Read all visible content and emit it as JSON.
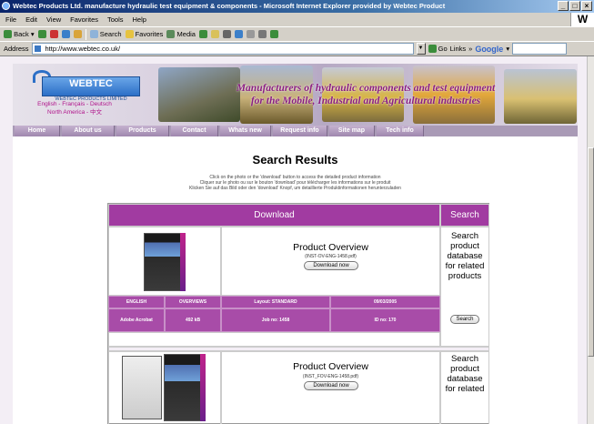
{
  "window": {
    "title": "Webtec Products Ltd. manufacture hydraulic test equipment & components - Microsoft Internet Explorer provided by Webtec Product",
    "buttons": [
      "_",
      "□",
      "×"
    ]
  },
  "menu": {
    "items": [
      "File",
      "Edit",
      "View",
      "Favorites",
      "Tools",
      "Help"
    ],
    "right_logo": "W"
  },
  "toolbar": {
    "back": "Back",
    "search": "Search",
    "favorites": "Favorites",
    "media": "Media"
  },
  "address": {
    "label": "Address",
    "url": "http://www.webtec.co.uk/",
    "go": "Go",
    "links": "Links",
    "google": "Google"
  },
  "site": {
    "logo": "WEBTEC",
    "logo_sub": "WEBTEC PRODUCTS LIMITED",
    "languages_line1": "English  -  Français  -  Deutsch",
    "languages_line2": "North America  -  中文",
    "tagline_line1": "Manufacturers of hydraulic components and test equipment",
    "tagline_line2": "for the Mobile, Industrial and Agricultural industries",
    "nav": [
      "Home",
      "About us",
      "Products",
      "Contact",
      "Whats new",
      "Request info",
      "Site map",
      "Tech info"
    ]
  },
  "results": {
    "title": "Search Results",
    "instructions": [
      "Click on the photo or the 'download' button to access the detailed product information",
      "Cliquer sur le photo ou sur le bouton 'download' pour télécharger les informations sur le produit",
      "Klicken Sie auf das Bild oder den 'download' Knopf, um detaillierte Produktinformationen herunterzuladen"
    ],
    "header_download": "Download",
    "header_search": "Search",
    "rows": [
      {
        "product_title": "Product Overview",
        "file": "(INST-OV-ENG-1458.pdf)",
        "download_label": "Download now",
        "search_text": "Search product database for related products",
        "search_button": "Search",
        "meta": {
          "language": "ENGLISH",
          "category": "OVERVIEWS",
          "layout": "Layout: STANDARD",
          "date": "09/03/2005",
          "reader": "Adobe Acrobat",
          "size": "492 kB",
          "job": "Job no: 1458",
          "id": "ID no: 170"
        }
      },
      {
        "product_title": "Product Overview",
        "file": "(INST_FOV-ENG-1458.pdf)",
        "download_label": "Download now",
        "search_text": "Search product database for related"
      }
    ]
  }
}
